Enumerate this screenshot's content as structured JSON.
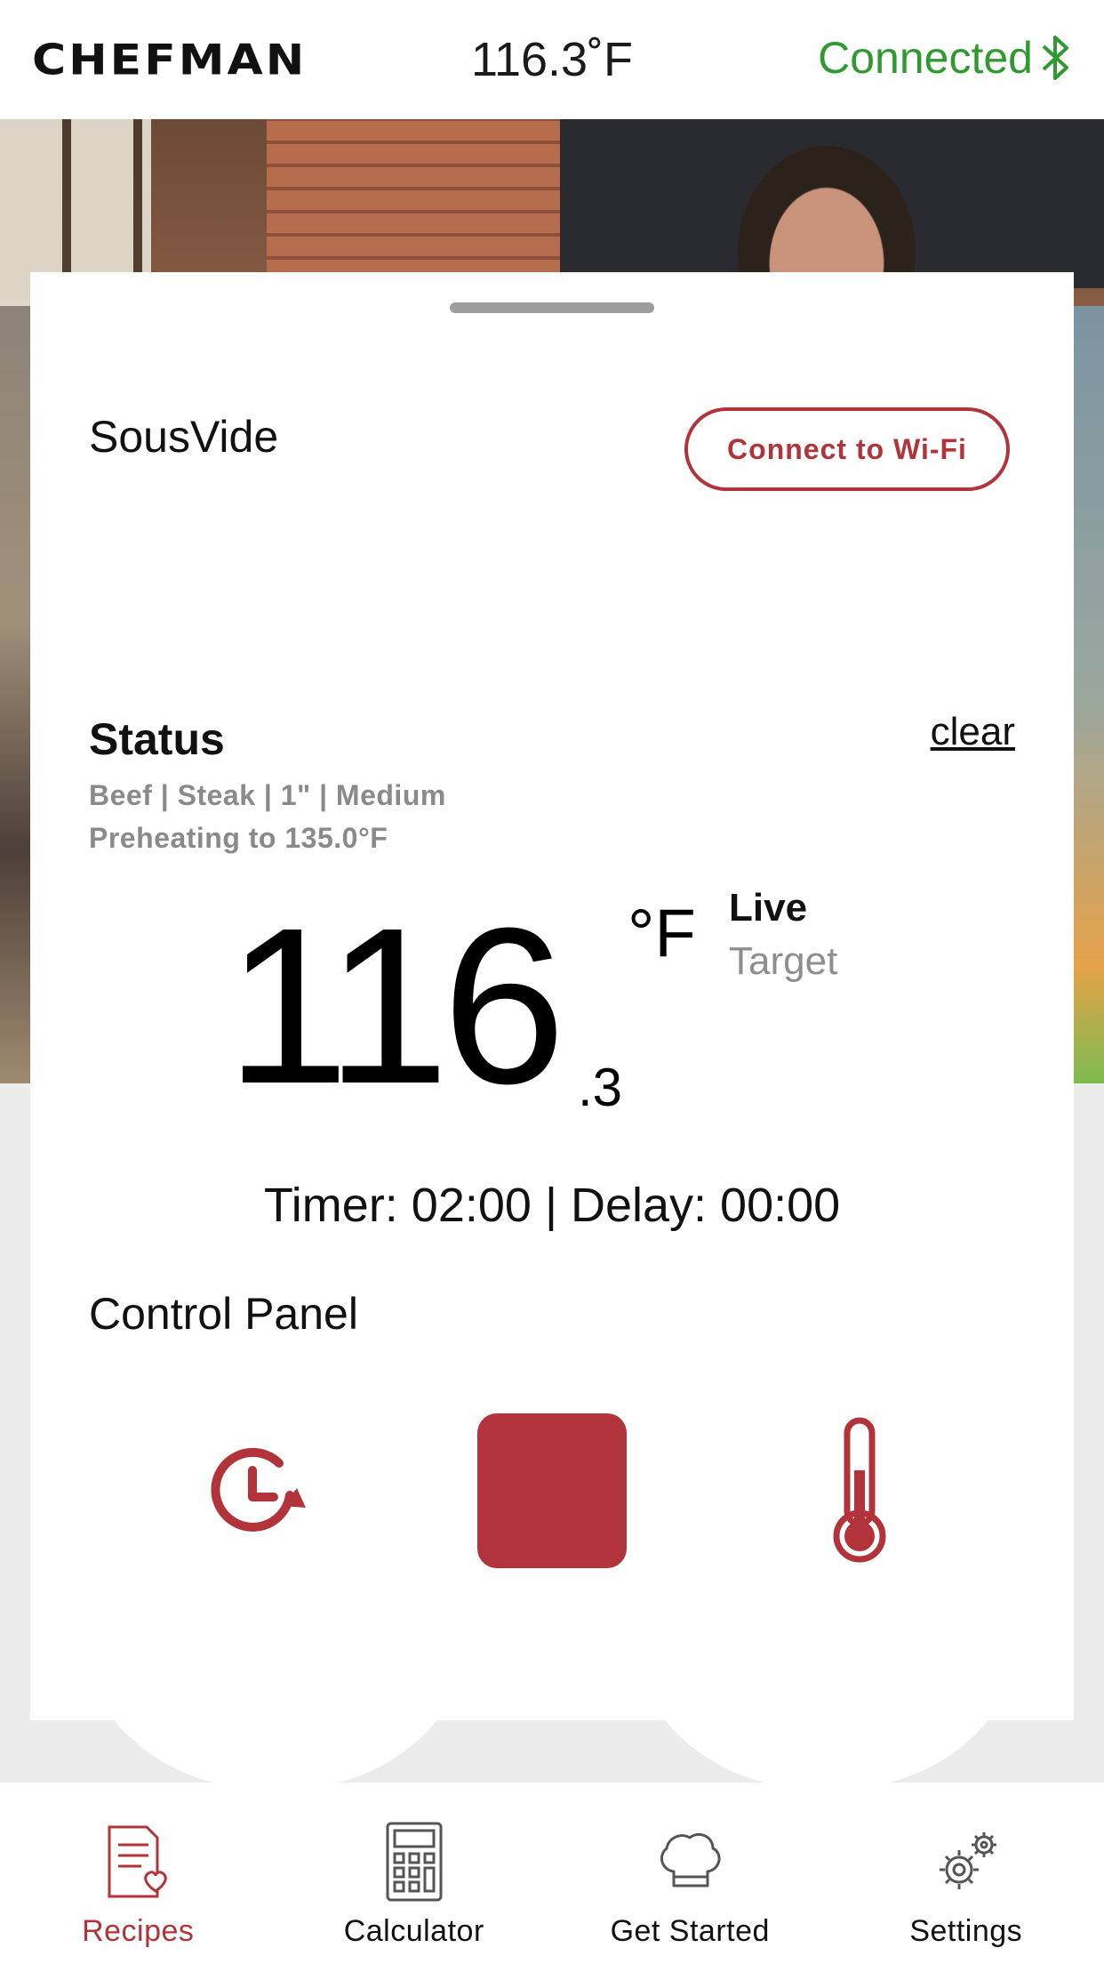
{
  "header": {
    "logo_text": "CHEFMAN",
    "temperature": "116.3˚F",
    "connection_status": "Connected",
    "connection_color": "#2f9a2f",
    "connection_icon": "bluetooth-icon"
  },
  "card": {
    "device_title": "SousVide",
    "wifi_button_label": "Connect to Wi-Fi",
    "status_heading": "Status",
    "clear_label": "clear",
    "recipe_line": "Beef | Steak | 1\" | Medium",
    "preheat_line": "Preheating to 135.0°F",
    "temp_integer": "116",
    "temp_decimal": ".3",
    "temp_unit": "°F",
    "mode_live": "Live",
    "mode_target": "Target",
    "timer_line": "Timer: 02:00 | Delay: 00:00",
    "control_panel_heading": "Control Panel",
    "controls": [
      {
        "name": "timer",
        "icon": "clock-timer-icon"
      },
      {
        "name": "stop",
        "icon": "stop-square-icon"
      },
      {
        "name": "temperature",
        "icon": "thermometer-icon"
      }
    ]
  },
  "tabs": [
    {
      "label": "Recipes",
      "icon": "recipes-icon",
      "active": true
    },
    {
      "label": "Calculator",
      "icon": "calculator-icon",
      "active": false
    },
    {
      "label": "Get Started",
      "icon": "chef-hat-icon",
      "active": false
    },
    {
      "label": "Settings",
      "icon": "gear-icon",
      "active": false
    }
  ],
  "colors": {
    "accent": "#b3333a",
    "connected": "#2f9a2f",
    "muted_text": "#8a8a8a"
  }
}
